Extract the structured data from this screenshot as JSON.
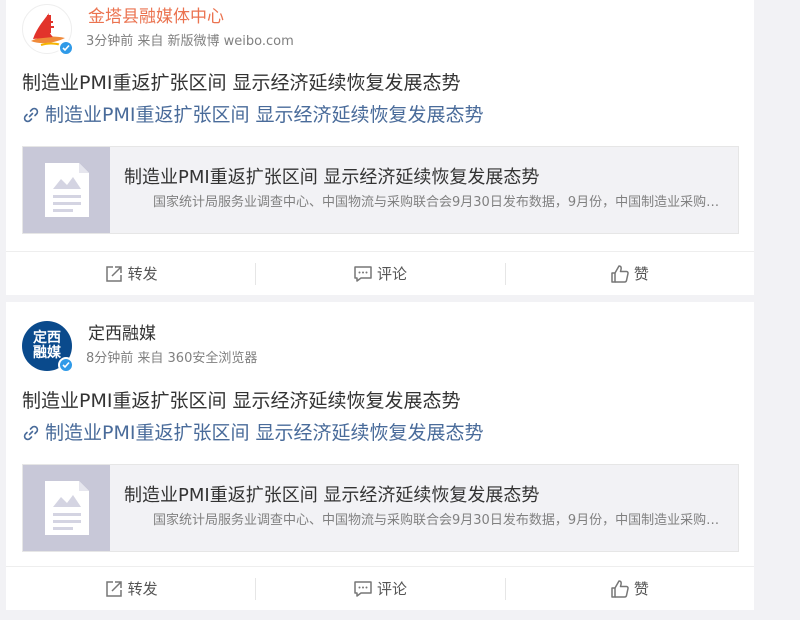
{
  "posts": [
    {
      "user": "金塔县融媒体中心",
      "meta": "3分钟前 来自 新版微博 weibo.com",
      "text": "制造业PMI重返扩张区间 显示经济延续恢复发展态势",
      "link_text": "制造业PMI重返扩张区间 显示经济延续恢复发展态势",
      "share_title": "制造业PMI重返扩张区间 显示经济延续恢复发展态势",
      "share_desc": "国家统计局服务业调查中心、中国物流与采购联合会9月30日发布数据，9月份，中国制造业采购经理指数",
      "actions": {
        "repost": "转发",
        "comment": "评论",
        "like": "赞"
      }
    },
    {
      "user": "定西融媒",
      "avatar_text": [
        "定西",
        "融媒"
      ],
      "meta": "8分钟前 来自 360安全浏览器",
      "text": "制造业PMI重返扩张区间 显示经济延续恢复发展态势",
      "link_text": "制造业PMI重返扩张区间 显示经济延续恢复发展态势",
      "share_title": "制造业PMI重返扩张区间 显示经济延续恢复发展态势",
      "share_desc": "国家统计局服务业调查中心、中国物流与采购联合会9月30日发布数据，9月份，中国制造业采购经理指数",
      "actions": {
        "repost": "转发",
        "comment": "评论",
        "like": "赞"
      }
    }
  ],
  "icons": {
    "link": "link-icon",
    "repost": "share-icon",
    "comment": "comment-icon",
    "like": "thumbs-up-icon",
    "verified": "verified-badge-icon",
    "thumb": "article-thumbnail-icon"
  },
  "colors": {
    "background": "#f2f2f5",
    "card": "#ffffff",
    "user_name_accent": "#eb7350",
    "link": "#496b9a",
    "muted_text": "#808080",
    "verified": "#2f9ae8",
    "thumb": "#c8c8d8",
    "avatar_2": "#0a4a8c"
  }
}
